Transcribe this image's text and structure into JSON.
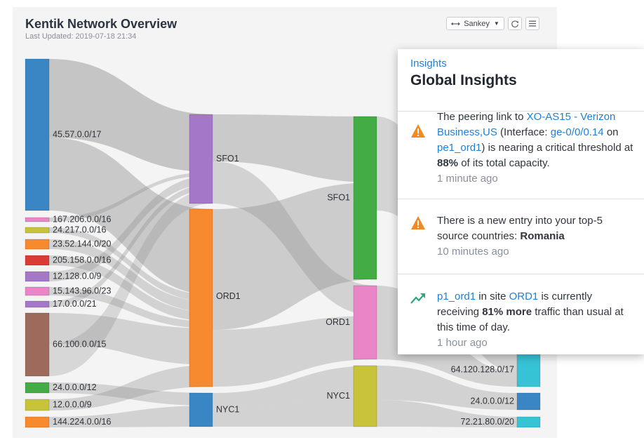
{
  "header": {
    "title": "Kentik Network Overview",
    "last_updated": "Last Updated: 2019-07-18 21:34"
  },
  "toolbar": {
    "view_label": "Sankey",
    "view_icon": "sankey-icon",
    "refresh_icon": "refresh-icon",
    "menu_icon": "hamburger-menu-icon"
  },
  "colors": {
    "blue": "#3a86c4",
    "pink": "#ea86c7",
    "olive": "#c7c43b",
    "orange": "#f7892f",
    "red": "#dc3b35",
    "purple": "#a477c9",
    "brown": "#9e6a5c",
    "green": "#44ac45",
    "teal": "#37c3d6",
    "link": "#1f7fd6",
    "warning": "#f4891f"
  },
  "sankey": {
    "sources": [
      {
        "label": "45.57.0.0/17",
        "color": "blue"
      },
      {
        "label": "167.206.0.0/16",
        "color": "pink"
      },
      {
        "label": "24.217.0.0/16",
        "color": "olive"
      },
      {
        "label": "23.52.144.0/20",
        "color": "orange"
      },
      {
        "label": "205.158.0.0/16",
        "color": "red"
      },
      {
        "label": "12.128.0.0/9",
        "color": "purple"
      },
      {
        "label": "15.143.96.0/23",
        "color": "pink"
      },
      {
        "label": "17.0.0.0/21",
        "color": "purple"
      },
      {
        "label": "66.100.0.0/15",
        "color": "brown"
      },
      {
        "label": "24.0.0.0/12",
        "color": "green"
      },
      {
        "label": "12.0.0.0/9",
        "color": "olive"
      },
      {
        "label": "144.224.0.0/16",
        "color": "orange"
      }
    ],
    "ingress_sites": [
      {
        "label": "SFO1",
        "color": "purple"
      },
      {
        "label": "ORD1",
        "color": "orange"
      },
      {
        "label": "NYC1",
        "color": "blue"
      }
    ],
    "egress_sites": [
      {
        "label": "SFO1",
        "color": "green"
      },
      {
        "label": "ORD1",
        "color": "pink"
      },
      {
        "label": "NYC1",
        "color": "olive"
      }
    ],
    "destinations": [
      {
        "label": "64.120.128.0/17",
        "color": "teal"
      },
      {
        "label": "24.0.0.0/12",
        "color": "blue"
      },
      {
        "label": "72.21.80.0/20",
        "color": "teal"
      }
    ]
  },
  "insights": {
    "kicker": "Insights",
    "title": "Global Insights",
    "items": [
      {
        "icon": "warning-icon",
        "t1": "The peering link to ",
        "l1": "XO-AS15 - Verizon Business,US",
        "t2": " (Interface: ",
        "l2": "ge-0/0/0.14",
        "t3": " on ",
        "l3": "pe1_ord1",
        "t4": ") is nearing a critical threshold at ",
        "b1": "88%",
        "t5": " of its total capacity.",
        "time": "1 minute ago"
      },
      {
        "icon": "warning-icon",
        "t1": "There is a new entry into your top-5 source countries: ",
        "b1": "Romania",
        "time": "10 minutes ago"
      },
      {
        "icon": "trend-up-icon",
        "l1": "p1_ord1",
        "t1": " in site ",
        "l2": "ORD1",
        "t2": " is currently receiving ",
        "b1": "81% more",
        "t3": " traffic than usual at this time of day.",
        "time": "1 hour ago"
      }
    ]
  }
}
